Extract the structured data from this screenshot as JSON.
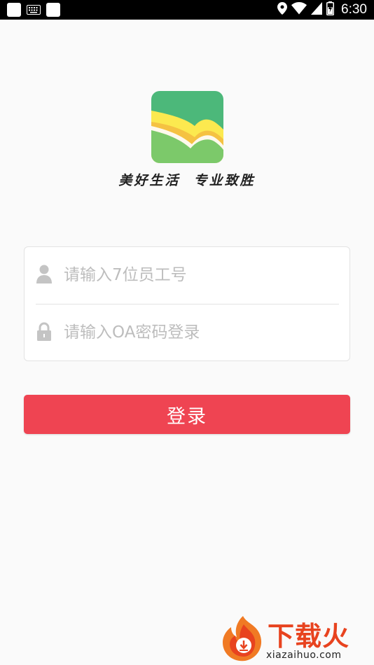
{
  "status_bar": {
    "time": "6:30",
    "battery_level": 0.6,
    "icons": [
      "app-square-icon",
      "keyboard-icon",
      "app-square-icon",
      "location-icon",
      "wifi-icon",
      "signal-icon",
      "battery-icon"
    ]
  },
  "branding": {
    "slogan": "美好生活  专业致胜",
    "logo_colors": [
      "#4cb87a",
      "#fce94f",
      "#f5c242",
      "#7cc96a"
    ]
  },
  "login_form": {
    "username_placeholder": "请输入7位员工号",
    "username_value": "",
    "password_placeholder": "请输入OA密码登录",
    "password_value": "",
    "submit_label": "登录"
  },
  "watermark": {
    "title": "下载火",
    "url": "xiazaihuo.com"
  },
  "colors": {
    "accent": "#ef4452",
    "background": "#fafafa",
    "placeholder": "#bdbdbd",
    "watermark": "#e8431f"
  }
}
